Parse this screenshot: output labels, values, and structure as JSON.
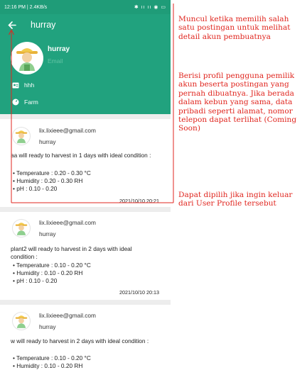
{
  "status_bar": {
    "text": "12:16 PM | 2.4KB/s",
    "icons": "✱ ıı ıı ◉ ▭"
  },
  "app_bar": {
    "title": "hurray"
  },
  "profile": {
    "name": "hurray",
    "email": "Email",
    "info": [
      {
        "icon": "person-card-icon",
        "label": "hhh"
      },
      {
        "icon": "plant-icon",
        "label": "Farm"
      }
    ]
  },
  "posts": [
    {
      "email": "lix.lixieee@gmail.com",
      "user": "hurray",
      "text": "aa will ready to harvest in 1 days with ideal condition :",
      "items": [
        "• Temperature : 0.20 - 0.30 °C",
        "• Humidity : 0.20 - 0.30 RH",
        "• pH : 0.10 - 0.20"
      ],
      "date": "2021/10/10 20:21"
    },
    {
      "email": "lix.lixieee@gmail.com",
      "user": "hurray",
      "text": "plant2 will ready to harvest in 2 days with ideal condition :",
      "items": [
        "• Temperature : 0.10 - 0.20 °C",
        "• Humidity : 0.10 - 0.20 RH",
        "• pH : 0.10 - 0.20"
      ],
      "date": "2021/10/10 20:13"
    },
    {
      "email": "lix.lixieee@gmail.com",
      "user": "hurray",
      "text": "w will ready to harvest in 2 days with ideal condition :",
      "items": [
        "• Temperature : 0.10 - 0.20 °C",
        "• Humidity : 0.10 - 0.20 RH"
      ],
      "date": ""
    }
  ],
  "annotations": {
    "note1": "Muncul ketika memilih salah satu postingan untuk melihat detail akun pembuatnya",
    "note2": "Berisi profil pengguna pemilik akun beserta postingan yang pernah dibuatnya. Jika berada dalam kebun yang sama, data pribadi seperti alamat, nomor telepon dapat terlihat (Coming Soon)",
    "note3": "Dapat dipilih jika ingin keluar dari User Profile tersebut"
  },
  "colors": {
    "primary": "#21a27e",
    "annotation": "#e0261f"
  }
}
